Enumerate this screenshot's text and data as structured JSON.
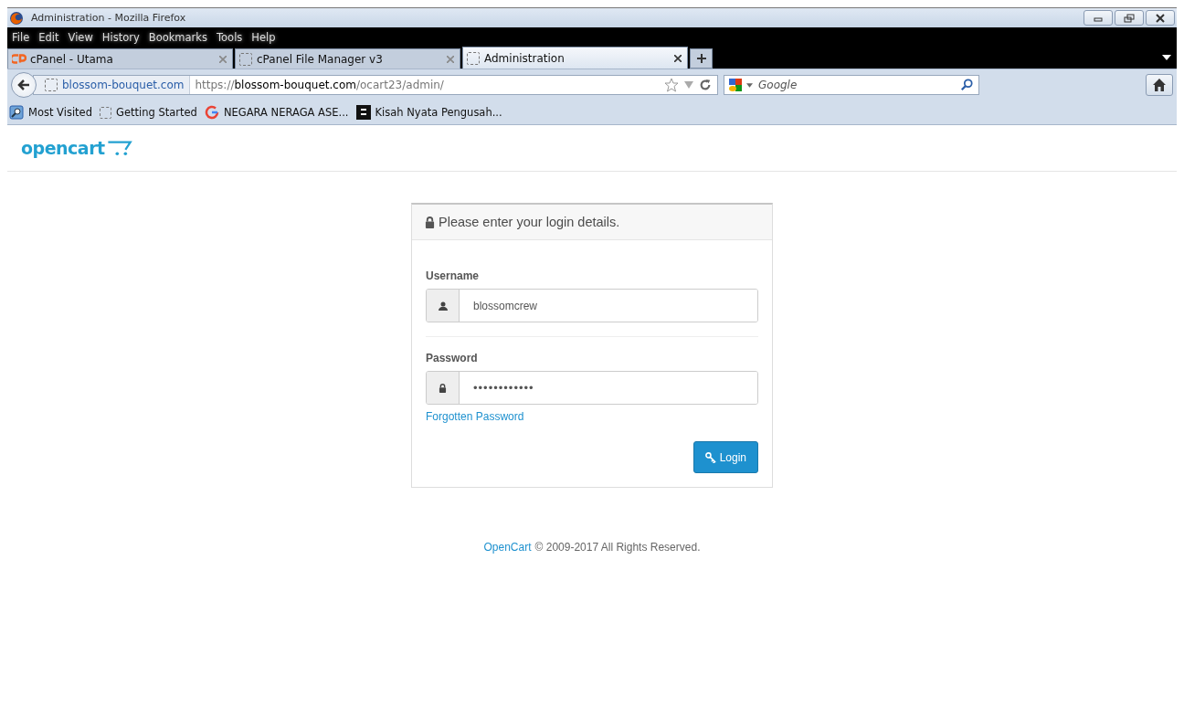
{
  "window": {
    "title": "Administration - Mozilla Firefox"
  },
  "menu": [
    "File",
    "Edit",
    "View",
    "History",
    "Bookmarks",
    "Tools",
    "Help"
  ],
  "tabs": [
    {
      "label": "cPanel - Utama",
      "kind": "cpanel",
      "selected": false
    },
    {
      "label": "cPanel File Manager v3",
      "kind": "blank",
      "selected": false
    },
    {
      "label": "Administration",
      "kind": "blank",
      "selected": true
    }
  ],
  "navbar": {
    "identity": "blossom-bouquet.com",
    "url_scheme": "https://",
    "url_host": "blossom-bouquet.com",
    "url_path": "/ocart23/admin/",
    "search_placeholder": "Google"
  },
  "bookmarks": [
    {
      "label": "Most Visited",
      "kind": "folder"
    },
    {
      "label": "Getting Started",
      "kind": "blank"
    },
    {
      "label": "NEGARA NERAGA ASE...",
      "kind": "google"
    },
    {
      "label": "Kisah Nyata Pengusah...",
      "kind": "dark"
    }
  ],
  "page": {
    "logo": "opencart",
    "panel": {
      "heading": "Please enter your login details.",
      "username_label": "Username",
      "username_value": "blossomcrew",
      "password_label": "Password",
      "password_value": "••••••••••••",
      "forgot_link": "Forgotten Password",
      "login_button": "Login"
    },
    "footer": {
      "link": "OpenCart",
      "text": "© 2009-2017 All Rights Reserved."
    }
  }
}
